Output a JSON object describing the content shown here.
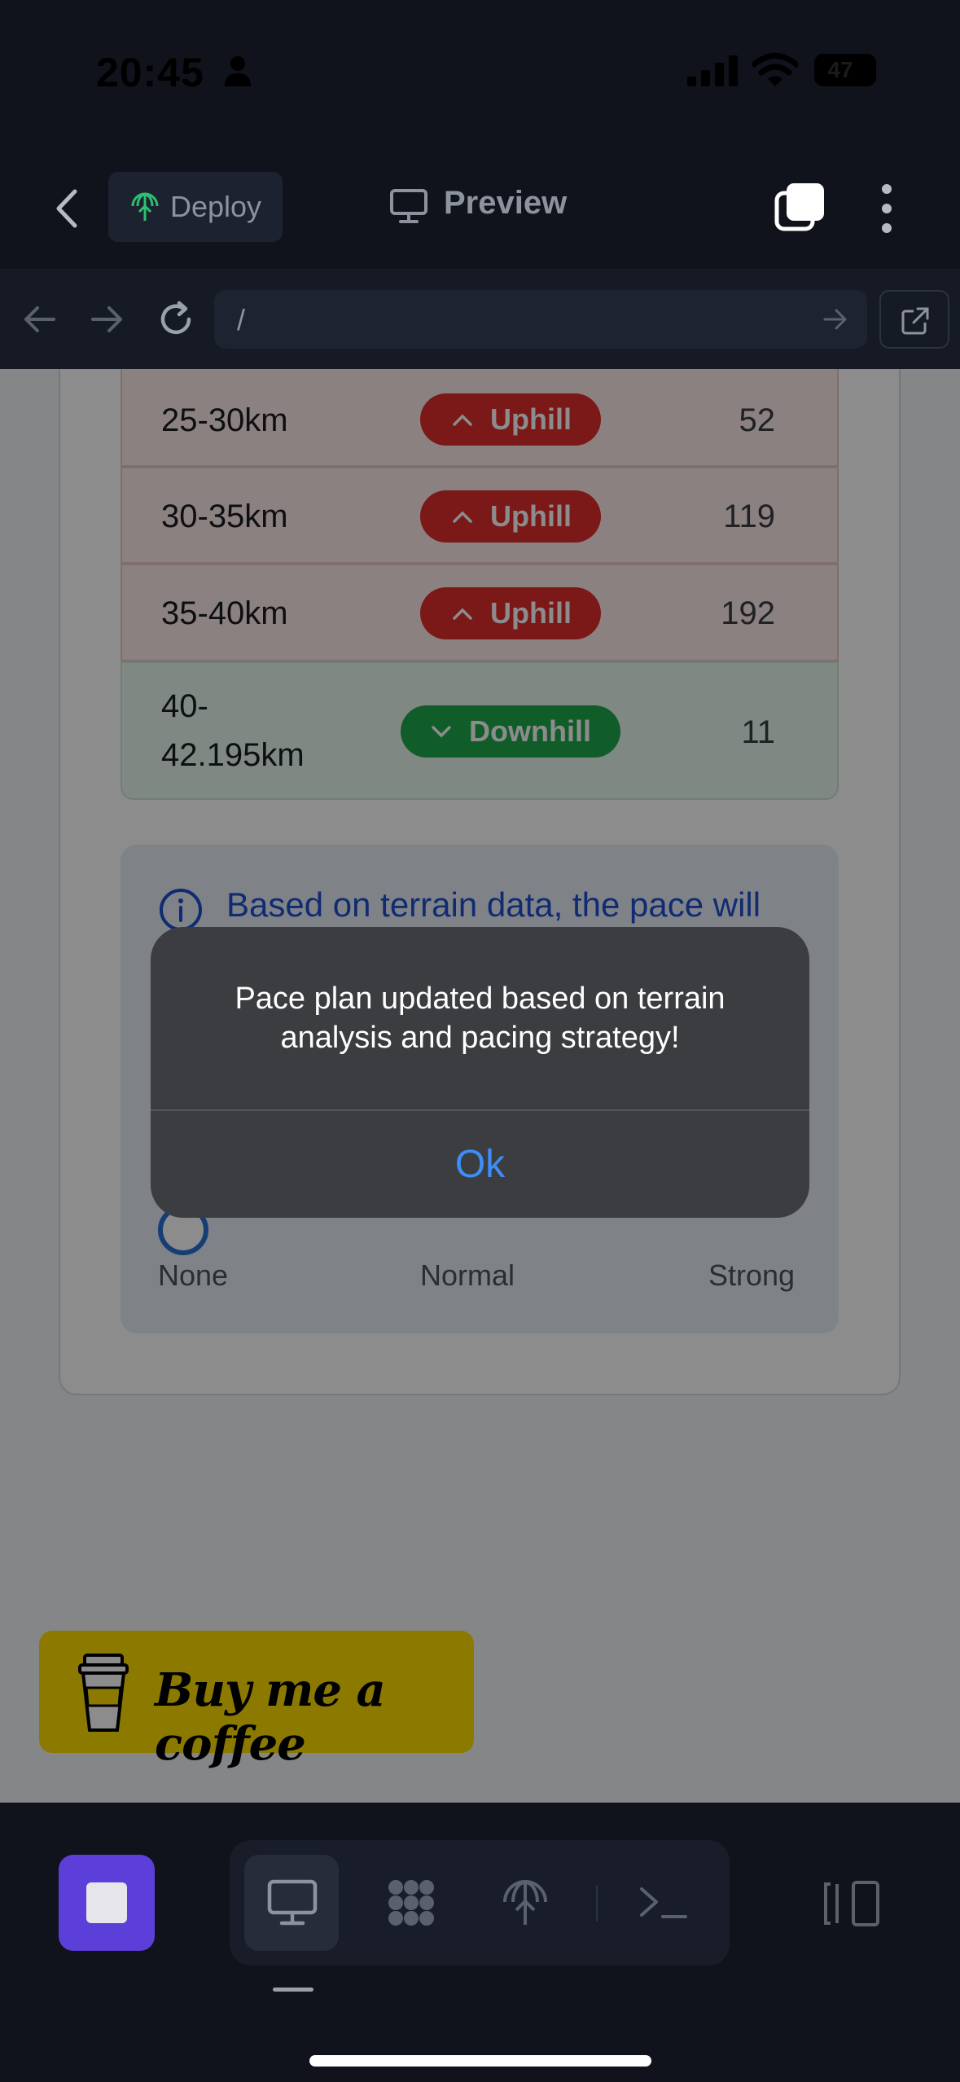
{
  "status_bar": {
    "time": "20:45",
    "battery": "47"
  },
  "header": {
    "deploy_label": "Deploy",
    "preview_label": "Preview"
  },
  "url_bar": {
    "url": "/"
  },
  "terrain_table": {
    "rows": [
      {
        "segment": "25-30km",
        "terrain": "Uphill",
        "elevation": "52"
      },
      {
        "segment": "30-35km",
        "terrain": "Uphill",
        "elevation": "119"
      },
      {
        "segment": "35-40km",
        "terrain": "Uphill",
        "elevation": "192"
      },
      {
        "segment_line1": "40-",
        "segment_line2": "42.195km",
        "terrain": "Downhill",
        "elevation": "11"
      }
    ]
  },
  "info_box": {
    "text": "Based on terrain data, the pace will",
    "scale": {
      "left": "None",
      "middle": "Normal",
      "right": "Strong"
    }
  },
  "coffee_button": {
    "label": "Buy me a coffee"
  },
  "alert": {
    "message": "Pace plan updated based on terrain analysis and pacing strategy!",
    "ok_label": "Ok"
  },
  "colors": {
    "uphill": "#e02c2c",
    "downhill": "#1faa4c",
    "info_text": "#1e4fcf",
    "alert_button": "#3e8ef7",
    "stop_button": "#5b3fd8",
    "coffee_yellow": "#ffdd00"
  },
  "icons": {
    "status": [
      "person-icon",
      "signal-icon",
      "wifi-icon"
    ],
    "header": [
      "back-icon",
      "deploy-icon",
      "preview-icon",
      "tabs-icon",
      "more-icon"
    ],
    "toolbar": [
      "stop-icon",
      "monitor-icon",
      "grid-icon",
      "deploy-icon",
      "terminal-icon",
      "panel-icon"
    ]
  }
}
